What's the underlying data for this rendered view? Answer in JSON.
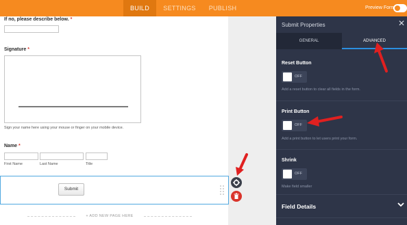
{
  "topbar": {
    "tabs": [
      {
        "label": "BUILD",
        "active": true
      },
      {
        "label": "SETTINGS",
        "active": false
      },
      {
        "label": "PUBLISH",
        "active": false
      }
    ],
    "preview_label": "Preview Form",
    "preview_on": true
  },
  "form": {
    "describe_label": "If no, please describe below.",
    "required_mark": "*",
    "signature_label": "Signature",
    "signature_hint": "Sign your name here using your mouse or finger on your mobile device.",
    "name_label": "Name",
    "name_sublabels": [
      "First Name",
      "Last Name",
      "Title"
    ],
    "submit_label": "Submit",
    "add_page": "+ ADD NEW PAGE HERE"
  },
  "panel": {
    "title": "Submit Properties",
    "close_icon": "close-icon",
    "tabs": [
      {
        "label": "GENERAL",
        "active": false
      },
      {
        "label": "ADVANCED",
        "active": true
      }
    ],
    "sections": [
      {
        "title": "Reset Button",
        "toggle": "OFF",
        "desc": "Add a reset button to clear all fields in the form."
      },
      {
        "title": "Print Button",
        "toggle": "OFF",
        "desc": "Add a print button to let users print your form."
      },
      {
        "title": "Shrink",
        "toggle": "OFF",
        "desc": "Make field smaller"
      }
    ],
    "field_details": "Field Details"
  },
  "colors": {
    "accent": "#f68a1f",
    "panel": "#2e3548",
    "selection": "#4fa7e0",
    "delete": "#d9342b",
    "annotation_arrow": "#e02020"
  }
}
